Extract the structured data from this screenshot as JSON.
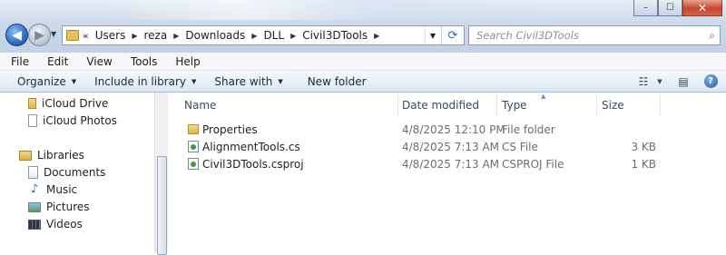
{
  "window": {
    "controls": {
      "minimize": "–",
      "maximize": "☐",
      "close": "✕"
    }
  },
  "nav": {
    "back_icon": "back-arrow-icon",
    "forward_icon": "forward-arrow-icon"
  },
  "address": {
    "prefix": "«",
    "crumbs": [
      "Users",
      "reza",
      "Downloads",
      "DLL",
      "Civil3DTools"
    ]
  },
  "search": {
    "placeholder": "Search Civil3DTools"
  },
  "menu": {
    "items": [
      "File",
      "Edit",
      "View",
      "Tools",
      "Help"
    ]
  },
  "commands": {
    "organize": "Organize",
    "include_in_library": "Include in library",
    "share_with": "Share with",
    "new_folder": "New folder",
    "help_glyph": "?"
  },
  "sidebar": {
    "items": [
      {
        "label": "iCloud Drive",
        "icon": "folder-icon"
      },
      {
        "label": "iCloud Photos",
        "icon": "document-icon"
      },
      {
        "label": "Libraries",
        "icon": "libraries-icon"
      },
      {
        "label": "Documents",
        "icon": "documents-icon"
      },
      {
        "label": "Music",
        "icon": "music-icon"
      },
      {
        "label": "Pictures",
        "icon": "pictures-icon"
      },
      {
        "label": "Videos",
        "icon": "videos-icon"
      }
    ]
  },
  "table": {
    "columns": [
      "Name",
      "Date modified",
      "Type",
      "Size"
    ],
    "rows": [
      {
        "name": "Properties",
        "date": "4/8/2025 12:10 PM",
        "type": "File folder",
        "size": "",
        "icon": "folder-icon"
      },
      {
        "name": "AlignmentTools.cs",
        "date": "4/8/2025 7:13 AM",
        "type": "CS File",
        "size": "3 KB",
        "icon": "cs-file-icon"
      },
      {
        "name": "Civil3DTools.csproj",
        "date": "4/8/2025 7:13 AM",
        "type": "CSPROJ File",
        "size": "1 KB",
        "icon": "csproj-file-icon"
      }
    ]
  },
  "colors": {
    "chrome_top": "#e7eef6",
    "chrome_bottom": "#c1d2e6",
    "close_red": "#c5482e",
    "accent_blue": "#2c6ec5"
  }
}
